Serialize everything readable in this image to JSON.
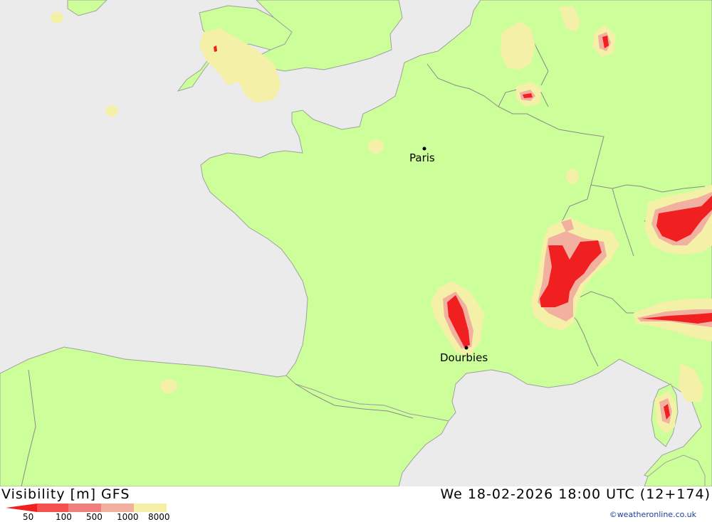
{
  "map": {
    "colors": {
      "sea": "#ebebeb",
      "land": "#ccff99",
      "border": "#a0a0a0",
      "vis_8000": "#f5f0a8",
      "vis_1000": "#f2b0a0",
      "vis_500": "#f08080",
      "vis_100": "#f55050",
      "vis_50": "#f02020"
    },
    "cities": [
      {
        "name": "Paris"
      },
      {
        "name": "Dourbies"
      }
    ]
  },
  "footer": {
    "title": "Visibility [m] GFS",
    "datetime": "We 18-02-2026 18:00 UTC (12+174)",
    "legend_labels": [
      "50",
      "100",
      "500",
      "1000",
      "8000"
    ],
    "credit": "©weatheronline.co.uk"
  }
}
